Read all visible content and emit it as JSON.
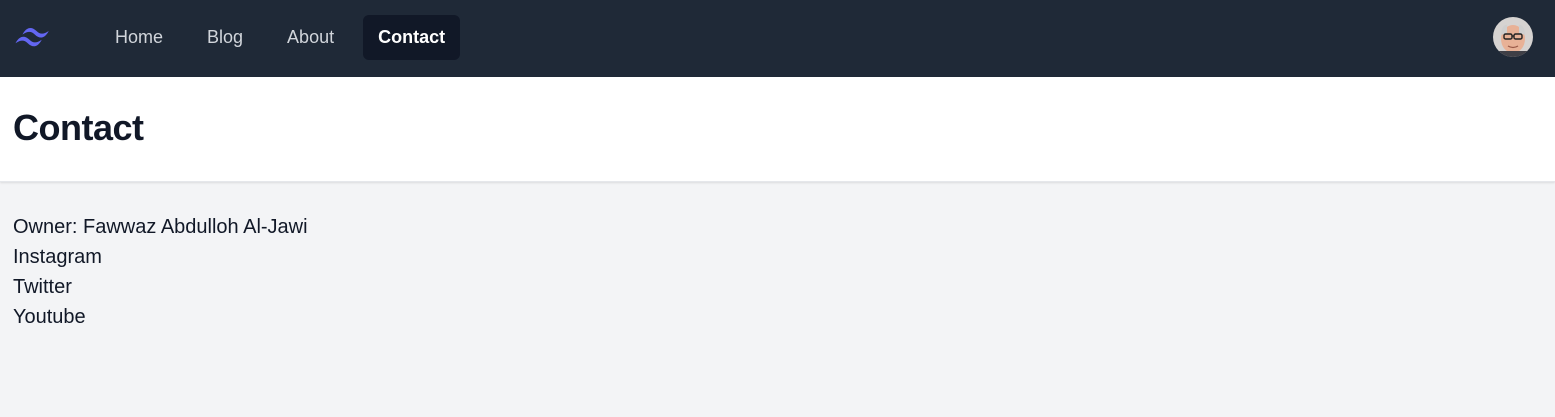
{
  "nav": {
    "logo_icon": "tailwind-logo-icon",
    "items": [
      {
        "label": "Home"
      },
      {
        "label": "Blog"
      },
      {
        "label": "About"
      },
      {
        "label": "Contact"
      }
    ],
    "active": "Contact",
    "avatar_icon": "user-avatar"
  },
  "header": {
    "title": "Contact"
  },
  "main": {
    "owner": "Owner: Fawwaz Abdulloh Al-Jawi",
    "links": [
      "Instagram",
      "Twitter",
      "Youtube"
    ]
  },
  "colors": {
    "navbar_bg": "#1f2937",
    "active_bg": "#111827",
    "accent": "#6366f1",
    "page_bg": "#f3f4f6"
  }
}
